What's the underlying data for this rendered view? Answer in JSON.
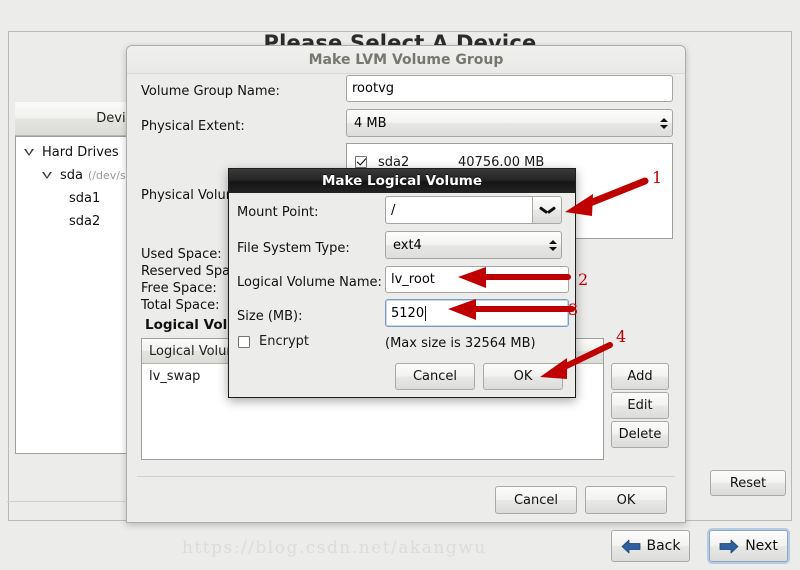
{
  "installer": {
    "background_title": "Please Select A Device",
    "device_column_header": "Device",
    "tree": [
      {
        "label": "Hard Drives",
        "path": "",
        "depth": 0,
        "expander": true
      },
      {
        "label": "sda",
        "path": "(/dev/sda)",
        "depth": 1,
        "expander": true
      },
      {
        "label": "sda1",
        "path": "",
        "depth": 2,
        "expander": false
      },
      {
        "label": "sda2",
        "path": "",
        "depth": 2,
        "expander": false
      }
    ],
    "reset_label": "Reset",
    "back_label": "Back",
    "next_label": "Next",
    "watermark": "https://blog.csdn.net/akangwu"
  },
  "lvm_dialog": {
    "title": "Make LVM Volume Group",
    "volume_group_name_label": "Volume Group Name:",
    "volume_group_name_value": "rootvg",
    "physical_extent_label": "Physical Extent:",
    "physical_extent_value": "4 MB",
    "physical_volumes_label": "Physical Volumes to Use:",
    "physical_volumes": [
      {
        "name": "sda2",
        "size": "40756.00 MB",
        "checked": true
      }
    ],
    "used_space_label": "Used Space:",
    "reserved_space_label": "Reserved Space:",
    "free_space_label": "Free Space:",
    "total_space_label": "Total Space:",
    "logical_volumes_heading": "Logical Volumes",
    "lv_column_header": "Logical Volume Name",
    "logical_volumes": [
      {
        "name": "lv_swap"
      }
    ],
    "add_label": "Add",
    "edit_label": "Edit",
    "delete_label": "Delete",
    "cancel_label": "Cancel",
    "ok_label": "OK"
  },
  "lv_dialog": {
    "title": "Make Logical Volume",
    "mount_point_label": "Mount Point:",
    "mount_point_value": "/",
    "file_system_type_label": "File System Type:",
    "file_system_type_value": "ext4",
    "logical_volume_name_label": "Logical Volume Name:",
    "logical_volume_name_value": "lv_root",
    "size_label": "Size (MB):",
    "size_value": "5120",
    "encrypt_label": "Encrypt",
    "encrypt_checked": false,
    "max_size_note": "(Max size is 32564 MB)",
    "cancel_label": "Cancel",
    "ok_label": "OK"
  },
  "annotations": {
    "numbers": [
      "1",
      "2",
      "3",
      "4"
    ],
    "color": "#c00000"
  }
}
